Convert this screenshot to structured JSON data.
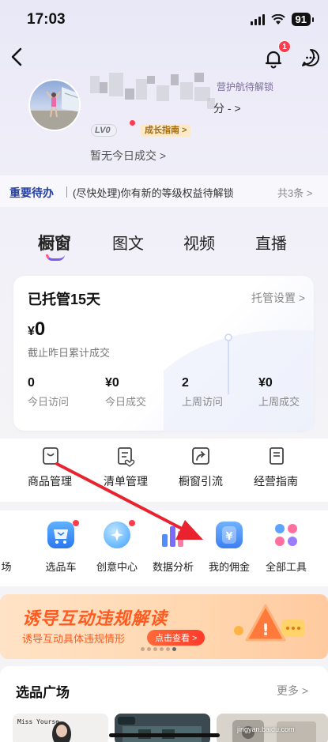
{
  "status": {
    "time": "17:03",
    "battery": "91"
  },
  "header": {
    "bell_badge": "1"
  },
  "profile": {
    "badge": "营护航待解锁",
    "score": "分 -   >",
    "level": "LV0",
    "guide": "成长指南 >",
    "no_deal": "暂无今日成交 >"
  },
  "todo": {
    "title": "重要待办",
    "text": "(尽快处理)你有新的等级权益待解锁",
    "count": "共3条 >"
  },
  "tabs": [
    "橱窗",
    "图文",
    "视频",
    "直播"
  ],
  "managed": {
    "title": "已托管15天",
    "setting": "托管设置 >",
    "amount_symbol": "¥",
    "amount": "0",
    "amount_label": "截止昨日累计成交",
    "stats": [
      {
        "value": "0",
        "label": "今日访问"
      },
      {
        "value": "¥0",
        "label": "今日成交"
      },
      {
        "value": "2",
        "label": "上周访问"
      },
      {
        "value": "¥0",
        "label": "上周成交"
      }
    ]
  },
  "tools": [
    "商品管理",
    "清单管理",
    "橱窗引流",
    "经营指南"
  ],
  "apps": [
    "场",
    "选品车",
    "创意中心",
    "数据分析",
    "我的佣金",
    "全部工具"
  ],
  "banner": {
    "title": "诱导互动违规解读",
    "sub": "诱导互动具体违规情形",
    "button": "点击查看 >"
  },
  "selection": {
    "title": "选品广场",
    "more": "更多 >",
    "thumb1_text": "Miss Yourse"
  },
  "watermark": "jingyan.baidu.com",
  "colors": {
    "accent": "#7a5cf0",
    "red": "#ff3b4e",
    "orange": "#ff5a1f",
    "todo_blue": "#2340a8"
  }
}
